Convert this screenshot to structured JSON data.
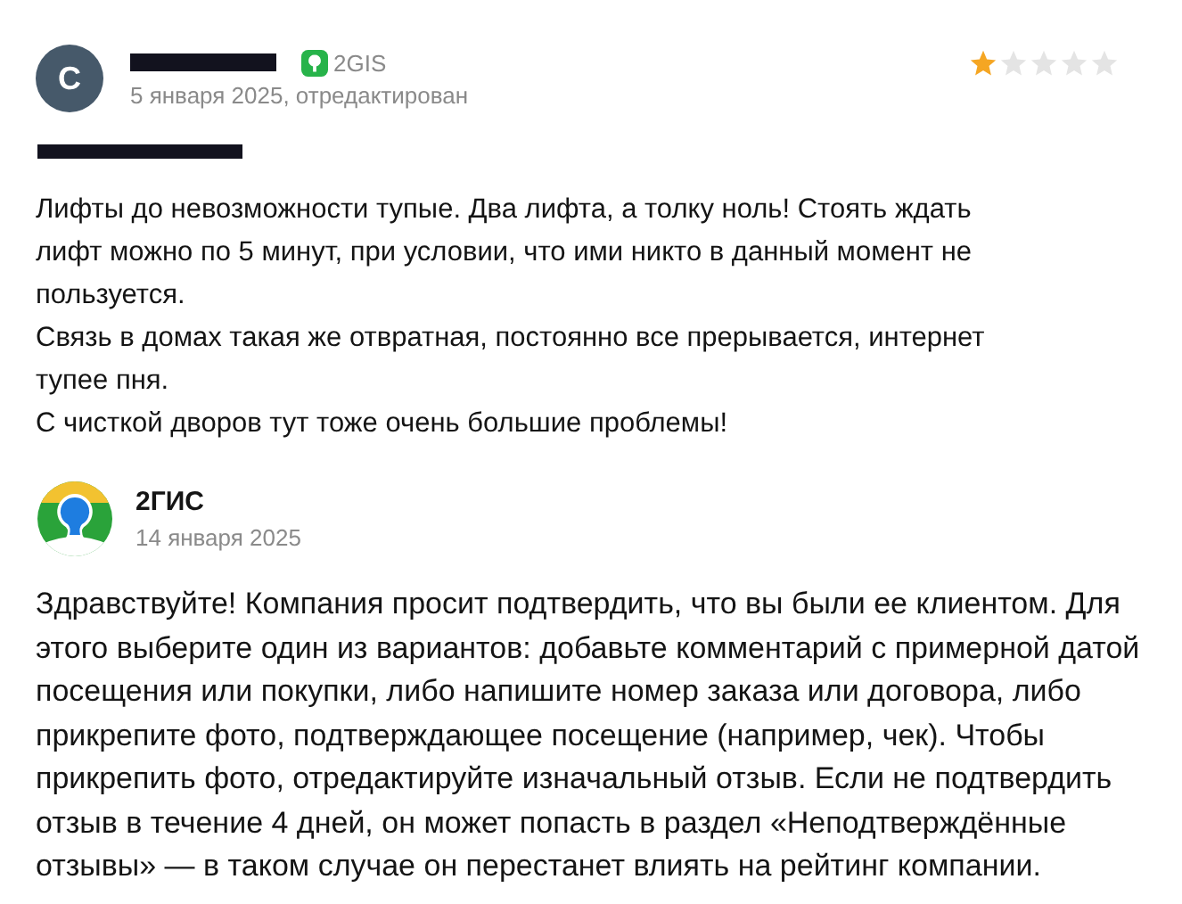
{
  "review": {
    "avatar_letter": "С",
    "source": "2GIS",
    "date": "5 января 2025, отредактирован",
    "stars": 1,
    "paragraphs": [
      "Лифты до невозможности тупые. Два лифта, а толку ноль! Стоять ждать лифт можно по 5 минут, при условии, что ими никто в данный момент не пользуется.",
      "Связь в домах такая же отвратная, постоянно все прерывается, интернет тупее пня.",
      "С чисткой дворов тут тоже очень большие проблемы!"
    ]
  },
  "reply": {
    "author": "2ГИС",
    "date": "14 января 2025",
    "text": "Здравствуйте! Компания просит подтвердить, что вы были ее клиентом. Для этого выберите один из вариантов: добавьте комментарий с примерной датой посещения или покупки, либо напишите номер заказа или договора, либо прикрепите фото, подтверждающее посещение (например, чек). Чтобы прикрепить фото, отредактируйте изначальный отзыв. Если не подтвердить отзыв в течение 4 дней, он может попасть в раздел «Неподтверждённые отзывы» — в таком случае он перестанет влиять на рейтинг компании."
  }
}
